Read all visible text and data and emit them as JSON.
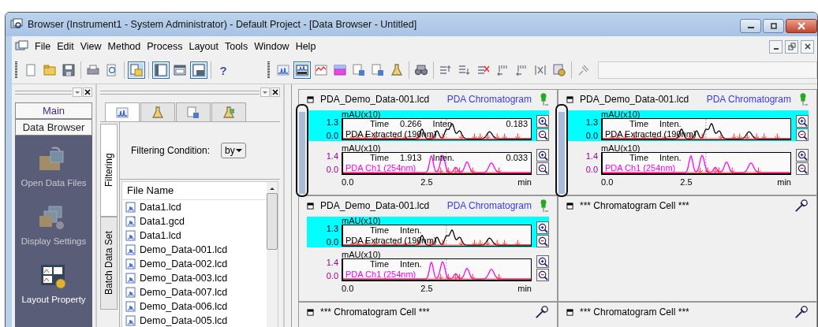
{
  "window": {
    "title": "Browser (Instrument1 - System Administrator) - Default Project - [Data Browser - Untitled]"
  },
  "menu": [
    "File",
    "Edit",
    "View",
    "Method",
    "Process",
    "Layout",
    "Tools",
    "Window",
    "Help"
  ],
  "toolbar_left": [
    {
      "kind": "new",
      "selected": false
    },
    {
      "kind": "open",
      "selected": false
    },
    {
      "kind": "save",
      "selected": false
    },
    {
      "kind": "separator"
    },
    {
      "kind": "print",
      "selected": false
    },
    {
      "kind": "preview",
      "selected": false
    },
    {
      "kind": "separator"
    },
    {
      "kind": "layout",
      "selected": true
    },
    {
      "kind": "separator"
    },
    {
      "kind": "pane",
      "selected": true
    },
    {
      "kind": "table",
      "selected": false
    },
    {
      "kind": "chart-pane",
      "selected": true
    },
    {
      "kind": "separator"
    },
    {
      "kind": "help",
      "selected": false,
      "label": "?"
    }
  ],
  "toolbar_right": [
    {
      "kind": "chromatogram",
      "selected": false
    },
    {
      "kind": "pda",
      "selected": true
    },
    {
      "kind": "pda-plot",
      "selected": false
    },
    {
      "kind": "contour",
      "selected": false
    },
    {
      "kind": "report",
      "selected": false
    },
    {
      "kind": "report",
      "selected": false
    },
    {
      "kind": "method",
      "selected": false
    },
    {
      "kind": "separator"
    },
    {
      "kind": "peak",
      "selected": false
    },
    {
      "kind": "separator"
    },
    {
      "kind": "list-add",
      "selected": false
    },
    {
      "kind": "list-down",
      "selected": false
    },
    {
      "kind": "list-delete",
      "selected": false
    },
    {
      "kind": "shift",
      "selected": false
    },
    {
      "kind": "shift",
      "selected": false
    },
    {
      "kind": "merge",
      "selected": false
    },
    {
      "kind": "settings",
      "selected": false
    },
    {
      "kind": "separator"
    },
    {
      "kind": "pin",
      "selected": false
    }
  ],
  "nav": {
    "groups": [
      {
        "label": "Main"
      },
      {
        "label": "Data Browser"
      }
    ],
    "items": [
      {
        "kind": "open",
        "label": "Open Data Files",
        "disabled": true
      },
      {
        "kind": "display",
        "label": "Display Settings",
        "disabled": true
      },
      {
        "kind": "layout",
        "label": "Layout Property",
        "disabled": false
      }
    ]
  },
  "browser": {
    "tabs": [
      {
        "kind": "chromatogram",
        "selected": true
      },
      {
        "kind": "method",
        "selected": false
      },
      {
        "kind": "report",
        "selected": false
      },
      {
        "kind": "batch",
        "selected": false
      }
    ],
    "side_tabs": [
      {
        "label": "Filtering",
        "selected": true
      },
      {
        "label": "Batch Data Set",
        "selected": false
      }
    ],
    "filter": {
      "label": "Filtering Condition:",
      "value": "by"
    },
    "file_list": {
      "column": "File Name",
      "rows": [
        {
          "name": "Data1.lcd",
          "kind": "lcd"
        },
        {
          "name": "Data1.gcd",
          "kind": "gcd"
        },
        {
          "name": "Data1.lcd",
          "kind": "lcd"
        },
        {
          "name": "Demo_Data-001.lcd",
          "kind": "lcd"
        },
        {
          "name": "Demo_Data-002.lcd",
          "kind": "lcd"
        },
        {
          "name": "Demo_Data-003.lcd",
          "kind": "lcd"
        },
        {
          "name": "Demo_Data-007.lcd",
          "kind": "lcd"
        },
        {
          "name": "Demo_Data-006.lcd",
          "kind": "lcd"
        },
        {
          "name": "Demo_Data-005.lcd",
          "kind": "lcd"
        }
      ]
    }
  },
  "cells": [
    {
      "kind": "data",
      "file": "PDA_Demo_Data-001.lcd",
      "type": "PDA Chromatogram",
      "scroller": true,
      "x_ticks": [
        "0.0",
        "2.5"
      ],
      "x_unit": "min",
      "plots": [
        {
          "selected": true,
          "y_label": "mAU(x10)",
          "y_ticks": [
            "1.3",
            "0.0"
          ],
          "time_label": "Time",
          "time_value": "0.266",
          "inten_label": "Inten.",
          "inten_value": "0.183",
          "trace": "PDA Extracted (190nm)",
          "color": "#000000"
        },
        {
          "selected": false,
          "y_label": "mAU(x10)",
          "y_ticks": [
            "1.4",
            "0.0"
          ],
          "time_label": "Time",
          "time_value": "1.913",
          "inten_label": "Inten.",
          "inten_value": "0.033",
          "trace": "PDA Ch1 (254nm)",
          "color": "#ff00ff"
        }
      ]
    },
    {
      "kind": "data",
      "file": "PDA_Demo_Data-001.lcd",
      "type": "PDA Chromatogram",
      "scroller": true,
      "x_ticks": [
        "0.0",
        "2.5"
      ],
      "x_unit": "min",
      "plots": [
        {
          "selected": true,
          "y_label": "mAU(x10)",
          "y_ticks": [
            "1.3",
            "0.0"
          ],
          "time_label": "Time",
          "inten_label": "Inten.",
          "trace": "PDA Extracted (190nm)",
          "color": "#000000"
        },
        {
          "selected": false,
          "y_label": "mAU(x10)",
          "y_ticks": [
            "1.4",
            "0.0"
          ],
          "time_label": "Time",
          "inten_label": "Inten.",
          "trace": "PDA Ch1 (254nm)",
          "color": "#ff00ff"
        }
      ]
    },
    {
      "kind": "data",
      "file": "PDA_Demo_Data-001.lcd",
      "type": "PDA Chromatogram",
      "scroller": false,
      "x_ticks": [
        "0.0",
        "2.5"
      ],
      "x_unit": "min",
      "plots": [
        {
          "selected": true,
          "y_label": "mAU(x10)",
          "y_ticks": [
            "1.3",
            "0.0"
          ],
          "time_label": "Time",
          "inten_label": "Inten.",
          "trace": "PDA Extracted (190nm)",
          "color": "#000000"
        },
        {
          "selected": false,
          "y_label": "mAU(x10)",
          "y_ticks": [
            "1.4",
            "0.0"
          ],
          "time_label": "Time",
          "inten_label": "Inten.",
          "trace": "PDA Ch1 (254nm)",
          "color": "#ff00ff"
        }
      ]
    },
    {
      "kind": "empty",
      "title": "*** Chromatogram Cell ***"
    },
    {
      "kind": "empty",
      "title": "*** Chromatogram Cell ***"
    },
    {
      "kind": "empty",
      "title": "*** Chromatogram Cell ***"
    }
  ]
}
